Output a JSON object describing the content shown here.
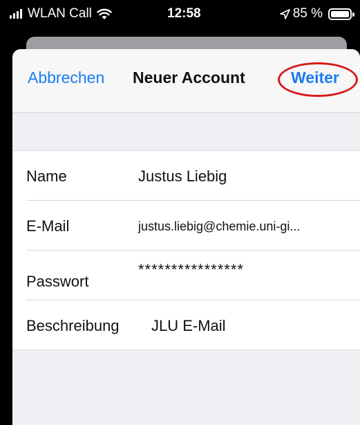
{
  "status_bar": {
    "carrier": "WLAN Call",
    "time": "12:58",
    "battery": "85 %",
    "battery_level": 0.85
  },
  "nav": {
    "cancel_label": "Abbrechen",
    "title": "Neuer Account",
    "next_label": "Weiter"
  },
  "form": {
    "rows": [
      {
        "label": "Name",
        "value": "Justus Liebig"
      },
      {
        "label": "E-Mail",
        "value": "justus.liebig@chemie.uni-gi..."
      },
      {
        "label": "Passwort",
        "value": "****************"
      },
      {
        "label": "Beschreibung",
        "value": "JLU E-Mail"
      }
    ]
  },
  "colors": {
    "accent": "#1a7cf0",
    "highlight_ring": "#d81a1a",
    "sheet_background": "#efeff4"
  }
}
